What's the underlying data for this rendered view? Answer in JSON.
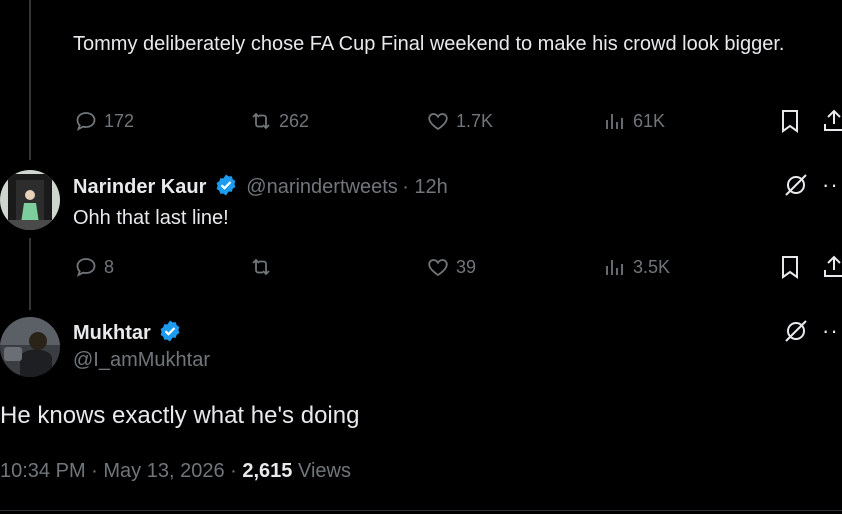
{
  "tweet1": {
    "text": "Tommy deliberately chose FA Cup Final weekend to make his crowd look bigger.",
    "stats": {
      "replies": "172",
      "retweets": "262",
      "likes": "1.7K",
      "views": "61K"
    }
  },
  "tweet2": {
    "name": "Narinder Kaur",
    "handle": "@narindertweets",
    "time": "· 12h",
    "text": "Ohh that last line!",
    "stats": {
      "replies": "8",
      "retweets": "",
      "likes": "39",
      "views": "3.5K"
    }
  },
  "tweet3": {
    "name": "Mukhtar",
    "handle": "@I_amMukhtar",
    "text": "He knows exactly what he's doing",
    "timestamp": "10:34 PM · May 13, 2026 ·",
    "views_count": "2,615",
    "views_label": "Views"
  },
  "colors": {
    "verified": "#1d9bf0",
    "muted": "#71767b",
    "text": "#e7e9ea",
    "background": "#000000"
  }
}
